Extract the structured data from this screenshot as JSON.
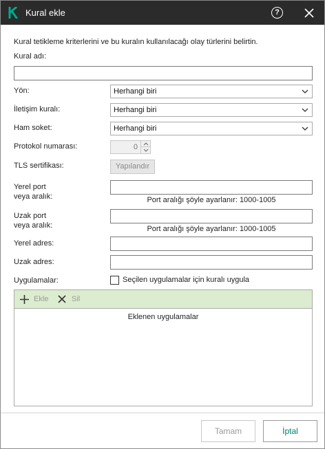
{
  "window": {
    "title": "Kural ekle",
    "help_glyph": "?",
    "logo_icon": "kaspersky-k-logo",
    "accent_color": "#00a88e"
  },
  "description": "Kural tetikleme kriterlerini ve bu kuralın kullanılacağı olay türlerini belirtin.",
  "fields": {
    "rule_name": {
      "label": "Kural adı:",
      "value": ""
    },
    "direction": {
      "label": "Yön:",
      "value": "Herhangi biri"
    },
    "protocol_rule": {
      "label": "İletişim kuralı:",
      "value": "Herhangi biri"
    },
    "raw_socket": {
      "label": "Ham soket:",
      "value": "Herhangi biri"
    },
    "protocol_number": {
      "label": "Protokol numarası:",
      "value": "0"
    },
    "tls": {
      "label": "TLS sertifikası:",
      "button": "Yapılandır"
    },
    "local_port": {
      "label_line1": "Yerel port",
      "label_line2": "veya aralık:",
      "value": "",
      "hint": "Port aralığı şöyle ayarlanır: 1000-1005"
    },
    "remote_port": {
      "label_line1": "Uzak port",
      "label_line2": "veya aralık:",
      "value": "",
      "hint": "Port aralığı şöyle ayarlanır: 1000-1005"
    },
    "local_address": {
      "label": "Yerel adres:",
      "value": ""
    },
    "remote_address": {
      "label": "Uzak adres:",
      "value": ""
    },
    "applications": {
      "label": "Uygulamalar:",
      "checkbox_label": "Seçilen uygulamalar için kuralı uygula",
      "checked": false
    }
  },
  "apps_panel": {
    "toolbar_color": "#dbeccf",
    "add_label": "Ekle",
    "remove_label": "Sil",
    "header": "Eklenen uygulamalar"
  },
  "footer": {
    "ok_label": "Tamam",
    "cancel_label": "İptal"
  }
}
